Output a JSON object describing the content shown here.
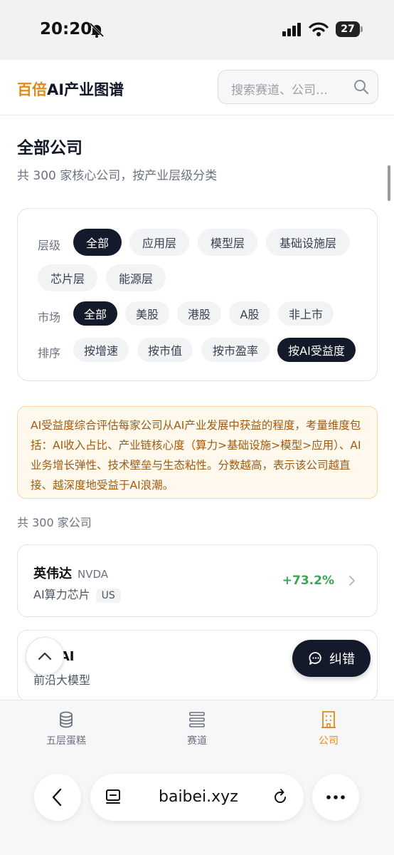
{
  "status_bar": {
    "time": "20:20",
    "battery": "27"
  },
  "header": {
    "brand_accent": "百倍",
    "brand_rest": "AI产业图谱",
    "search_placeholder": "搜索赛道、公司…"
  },
  "page": {
    "title": "全部公司",
    "subtitle": "共 300 家核心公司，按产业层级分类"
  },
  "filters": {
    "layer": {
      "label": "层级",
      "options": [
        "全部",
        "应用层",
        "模型层",
        "基础设施层",
        "芯片层",
        "能源层"
      ],
      "selected": "全部"
    },
    "market": {
      "label": "市场",
      "options": [
        "全部",
        "美股",
        "港股",
        "A股",
        "非上市"
      ],
      "selected": "全部"
    },
    "sort": {
      "label": "排序",
      "options": [
        "按增速",
        "按市值",
        "按市盈率",
        "按AI受益度"
      ],
      "selected": "按AI受益度"
    }
  },
  "info_text": "AI受益度综合评估每家公司从AI产业发展中获益的程度，考量维度包括：AI收入占比、产业链核心度（算力>基础设施>模型>应用）、AI业务增长弹性、技术壁垒与生态粘性。分数越高，表示该公司越直接、越深度地受益于AI浪潮。",
  "count_text": "共 300 家公司",
  "companies": [
    {
      "name": "英伟达",
      "ticker": "NVDA",
      "sector": "AI算力芯片",
      "market_tag": "US",
      "growth": "+73.2%"
    },
    {
      "name": "nAI",
      "sector": "前沿大模型"
    }
  ],
  "feedback_label": "纠错",
  "bottom_nav": [
    {
      "label": "五层蛋糕",
      "icon": "cake-icon",
      "active": false
    },
    {
      "label": "赛道",
      "icon": "layers-icon",
      "active": false
    },
    {
      "label": "公司",
      "icon": "building-icon",
      "active": true
    }
  ],
  "browser": {
    "url": "baibei.xyz"
  },
  "colors": {
    "accent": "#e08a1e",
    "dark": "#141a2a",
    "positive": "#3aa655",
    "info_bg": "#fff8ec",
    "info_text": "#a05a12"
  }
}
